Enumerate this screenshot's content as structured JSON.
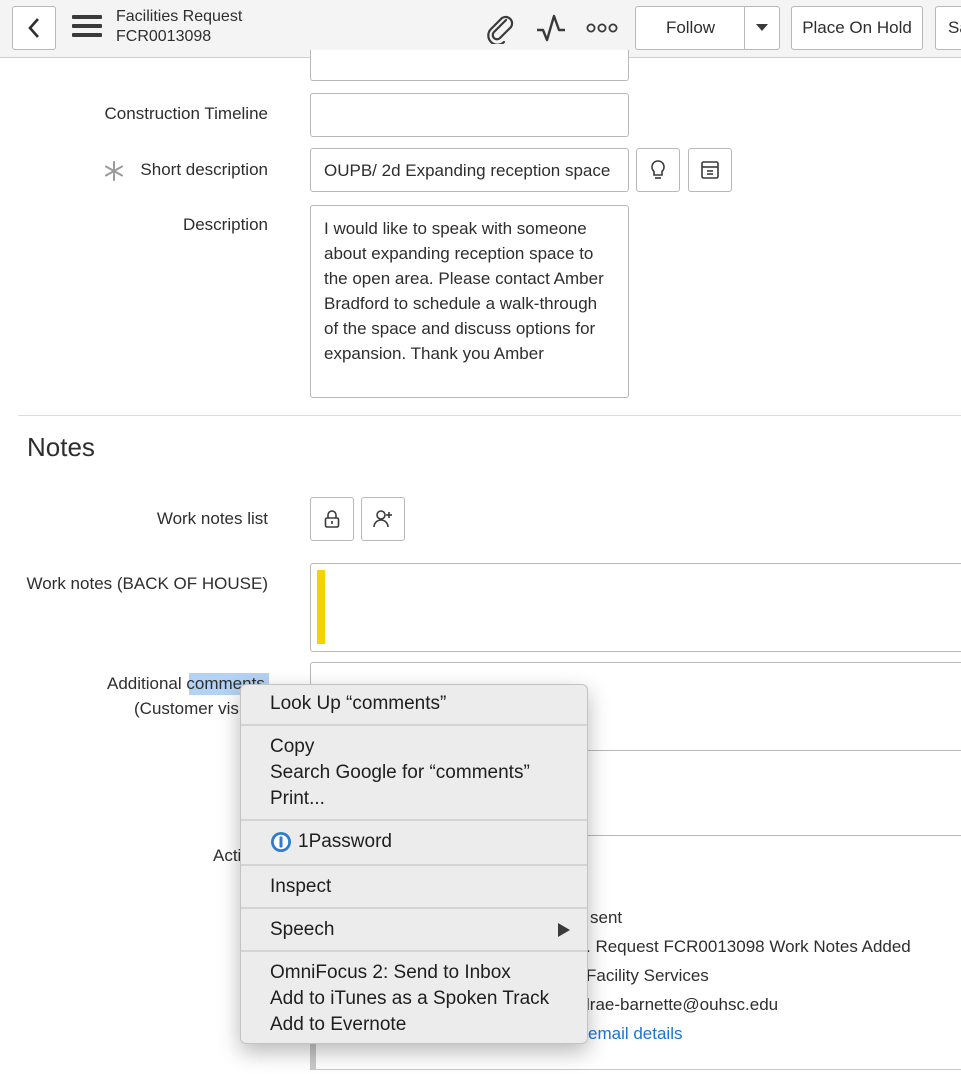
{
  "header": {
    "title": "Facilities Request",
    "number": "FCR0013098",
    "follow_label": "Follow",
    "hold_label": "Place On Hold",
    "save_label": "Save"
  },
  "form": {
    "construction_timeline_label": "Construction Timeline",
    "construction_timeline_value": "",
    "short_description_label": "Short description",
    "short_description_value": "OUPB/ 2d Expanding reception space",
    "description_label": "Description",
    "description_value": "I would like to speak with someone about expanding reception space to the open area. Please contact Amber Bradford to schedule a walk-through of the space and discuss options for expansion. Thank you Amber"
  },
  "notes": {
    "section_title": "Notes",
    "work_notes_list_label": "Work notes list",
    "work_notes_label": "Work notes (BACK OF HOUSE)",
    "work_notes_value": "",
    "additional_comments_prefix": "Additional ",
    "additional_comments_selected": "comments",
    "additional_comments_line2": "(Customer visi",
    "activity_label_partial": "Acti"
  },
  "activity": {
    "sent": "sent",
    "subject": ". Request FCR0013098 Work Notes Added",
    "from": "Facility Services",
    "to": "lrae-barnette@ouhsc.edu",
    "details_link": "email details"
  },
  "context_menu": {
    "look_up": "Look Up “comments”",
    "copy": "Copy",
    "search_google": "Search Google for “comments”",
    "print": "Print...",
    "onepassword": "1Password",
    "inspect": "Inspect",
    "speech": "Speech",
    "omnifocus": "OmniFocus 2: Send to Inbox",
    "itunes": "Add to iTunes as a Spoken Track",
    "evernote": "Add to Evernote"
  },
  "colors": {
    "accent_link": "#1a73d6",
    "work_notes_bar": "#f3d400",
    "selection": "#b3d3f5"
  }
}
